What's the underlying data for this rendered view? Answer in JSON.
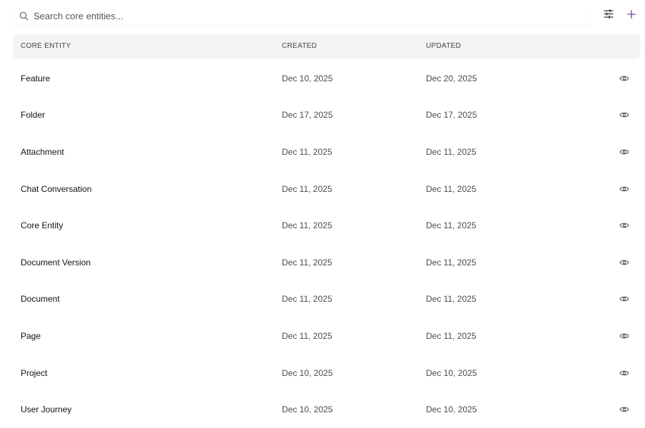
{
  "search": {
    "placeholder": "Search core entities..."
  },
  "toolbar": {
    "filter_icon": "sliders-icon",
    "add_icon": "plus-icon",
    "accent_color": "#6b3fa0"
  },
  "table": {
    "columns": [
      "CORE ENTITY",
      "CREATED",
      "UPDATED"
    ],
    "rows": [
      {
        "name": "Feature",
        "created": "Dec 10, 2025",
        "updated": "Dec 20, 2025"
      },
      {
        "name": "Folder",
        "created": "Dec 17, 2025",
        "updated": "Dec 17, 2025"
      },
      {
        "name": "Attachment",
        "created": "Dec 11, 2025",
        "updated": "Dec 11, 2025"
      },
      {
        "name": "Chat Conversation",
        "created": "Dec 11, 2025",
        "updated": "Dec 11, 2025"
      },
      {
        "name": "Core Entity",
        "created": "Dec 11, 2025",
        "updated": "Dec 11, 2025"
      },
      {
        "name": "Document Version",
        "created": "Dec 11, 2025",
        "updated": "Dec 11, 2025"
      },
      {
        "name": "Document",
        "created": "Dec 11, 2025",
        "updated": "Dec 11, 2025"
      },
      {
        "name": "Page",
        "created": "Dec 11, 2025",
        "updated": "Dec 11, 2025"
      },
      {
        "name": "Project",
        "created": "Dec 10, 2025",
        "updated": "Dec 10, 2025"
      },
      {
        "name": "User Journey",
        "created": "Dec 10, 2025",
        "updated": "Dec 10, 2025"
      }
    ],
    "row_action_icon": "eye-icon"
  }
}
